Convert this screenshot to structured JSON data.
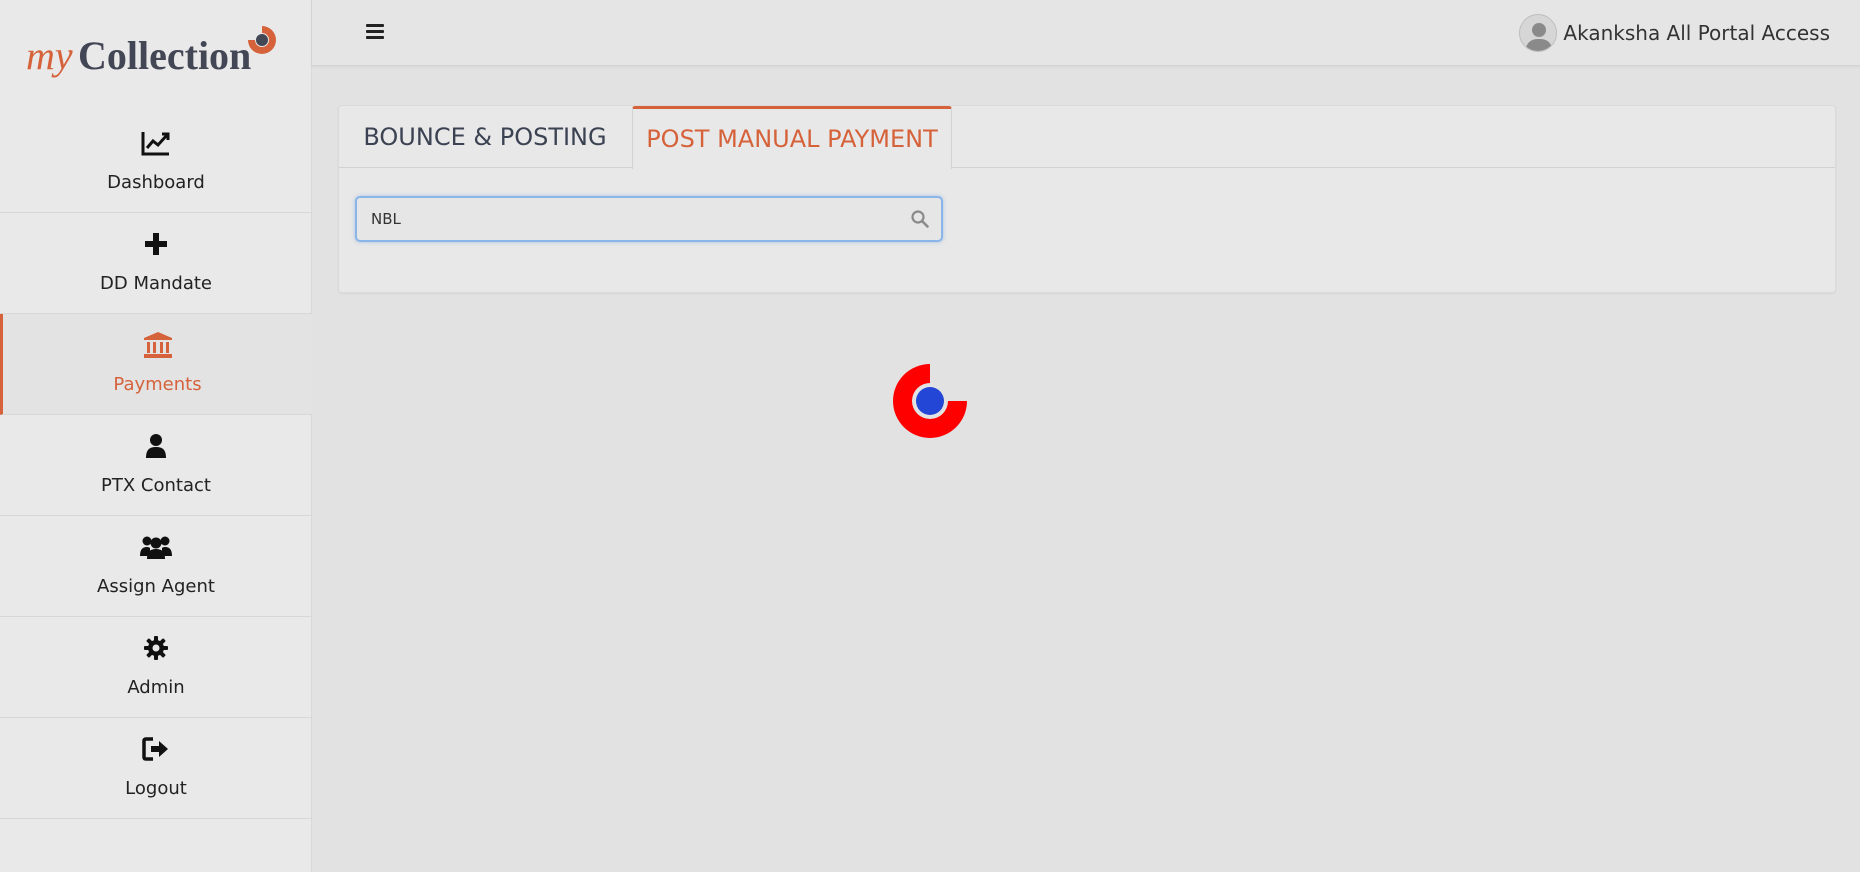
{
  "logo": {
    "part1": "my",
    "part2": "Collection"
  },
  "sidebar": {
    "items": [
      {
        "label": "Dashboard",
        "icon": "chart-line-icon"
      },
      {
        "label": "DD Mandate",
        "icon": "plus-icon"
      },
      {
        "label": "Payments",
        "icon": "bank-icon",
        "active": true
      },
      {
        "label": "PTX Contact",
        "icon": "user-icon"
      },
      {
        "label": "Assign Agent",
        "icon": "users-icon"
      },
      {
        "label": "Admin",
        "icon": "gear-icon"
      },
      {
        "label": "Logout",
        "icon": "sign-out-icon"
      }
    ]
  },
  "header": {
    "user_name": "Akanksha All Portal Access"
  },
  "tabs": [
    {
      "label": "BOUNCE & POSTING",
      "active": false
    },
    {
      "label": "POST MANUAL PAYMENT",
      "active": true
    }
  ],
  "search": {
    "value": "NBL",
    "placeholder": ""
  },
  "colors": {
    "accent": "#d5623a",
    "loader_ring": "#ff0000",
    "loader_dot": "#2446d6"
  }
}
